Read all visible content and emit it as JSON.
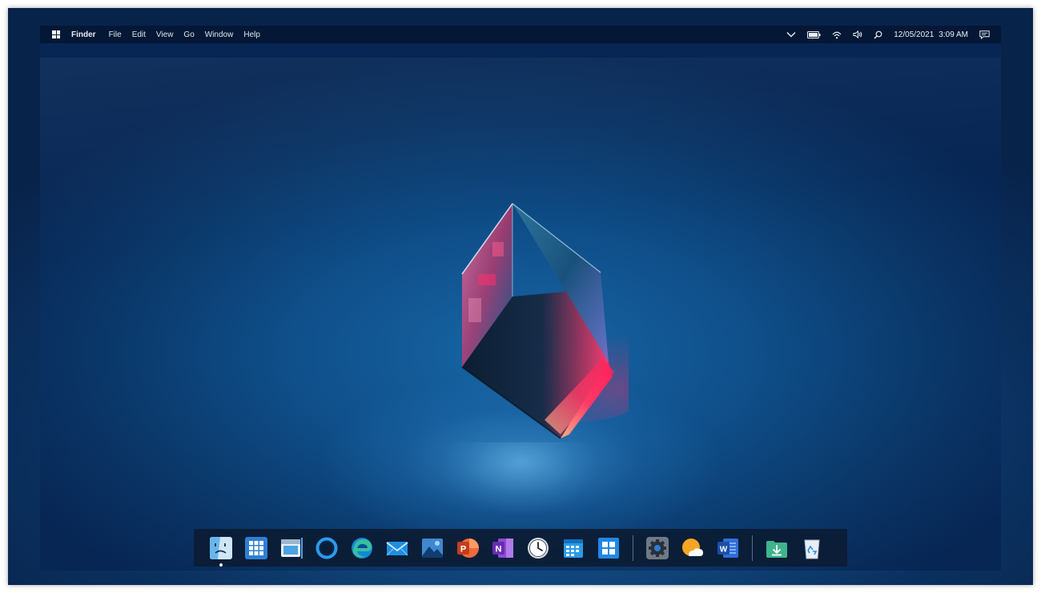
{
  "menubar": {
    "app_name": "Finder",
    "items": [
      "File",
      "Edit",
      "View",
      "Go",
      "Window",
      "Help"
    ],
    "date": "12/05/2021",
    "time": "3:09 AM",
    "tray_icons": [
      "chevron-down-icon",
      "battery-icon",
      "wifi-icon",
      "volume-icon",
      "search-icon",
      "notification-icon"
    ]
  },
  "wallpaper": {
    "subject": "glass-cube",
    "colors": {
      "background": "#0f4f8a",
      "glow_pink": "#ff2d6b",
      "glow_cyan": "#4fd0e6"
    }
  },
  "dock": {
    "left_icons": [
      "finder-icon",
      "launchpad-icon",
      "file-explorer-icon",
      "cortana-icon",
      "edge-icon",
      "mail-icon",
      "photos-icon",
      "powerpoint-icon",
      "onenote-icon",
      "clock-icon",
      "calendar-icon",
      "windows-store-icon"
    ],
    "middle_icons": [
      "settings-icon",
      "weather-icon",
      "word-icon"
    ],
    "right_icons": [
      "downloads-folder-icon",
      "recycle-bin-icon"
    ],
    "running_app": "finder-icon"
  }
}
